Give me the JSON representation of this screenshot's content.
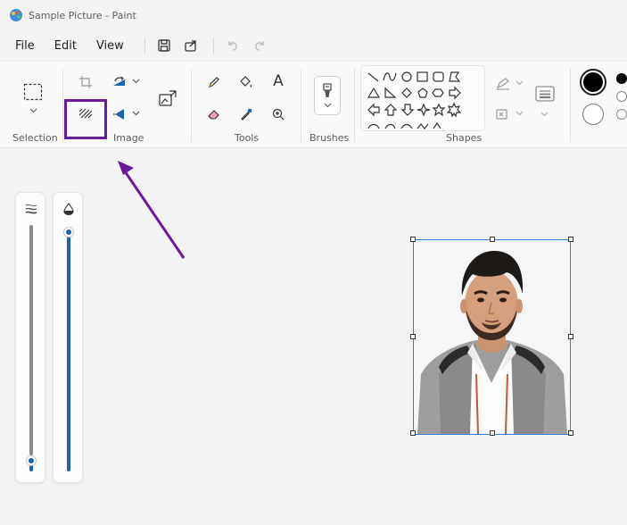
{
  "window": {
    "title": "Sample Picture - Paint"
  },
  "menu": {
    "file": "File",
    "edit": "Edit",
    "view": "View"
  },
  "ribbon": {
    "groups": {
      "selection": "Selection",
      "image": "Image",
      "tools": "Tools",
      "brushes": "Brushes",
      "shapes": "Shapes"
    },
    "tools": {
      "text_glyph": "A"
    }
  },
  "colors": {
    "accent": "#1a63b8",
    "highlight_box": "#6a1b9a",
    "annotation_arrow": "#6a1b9a",
    "selection_border": "#2f7fd6"
  },
  "sliders": {
    "size": {
      "icon": "stroke-size-icon",
      "level": 0.02
    },
    "opacity": {
      "icon": "opacity-drop-icon",
      "level": 1.0
    }
  },
  "canvas": {
    "image": "portrait-photo"
  }
}
